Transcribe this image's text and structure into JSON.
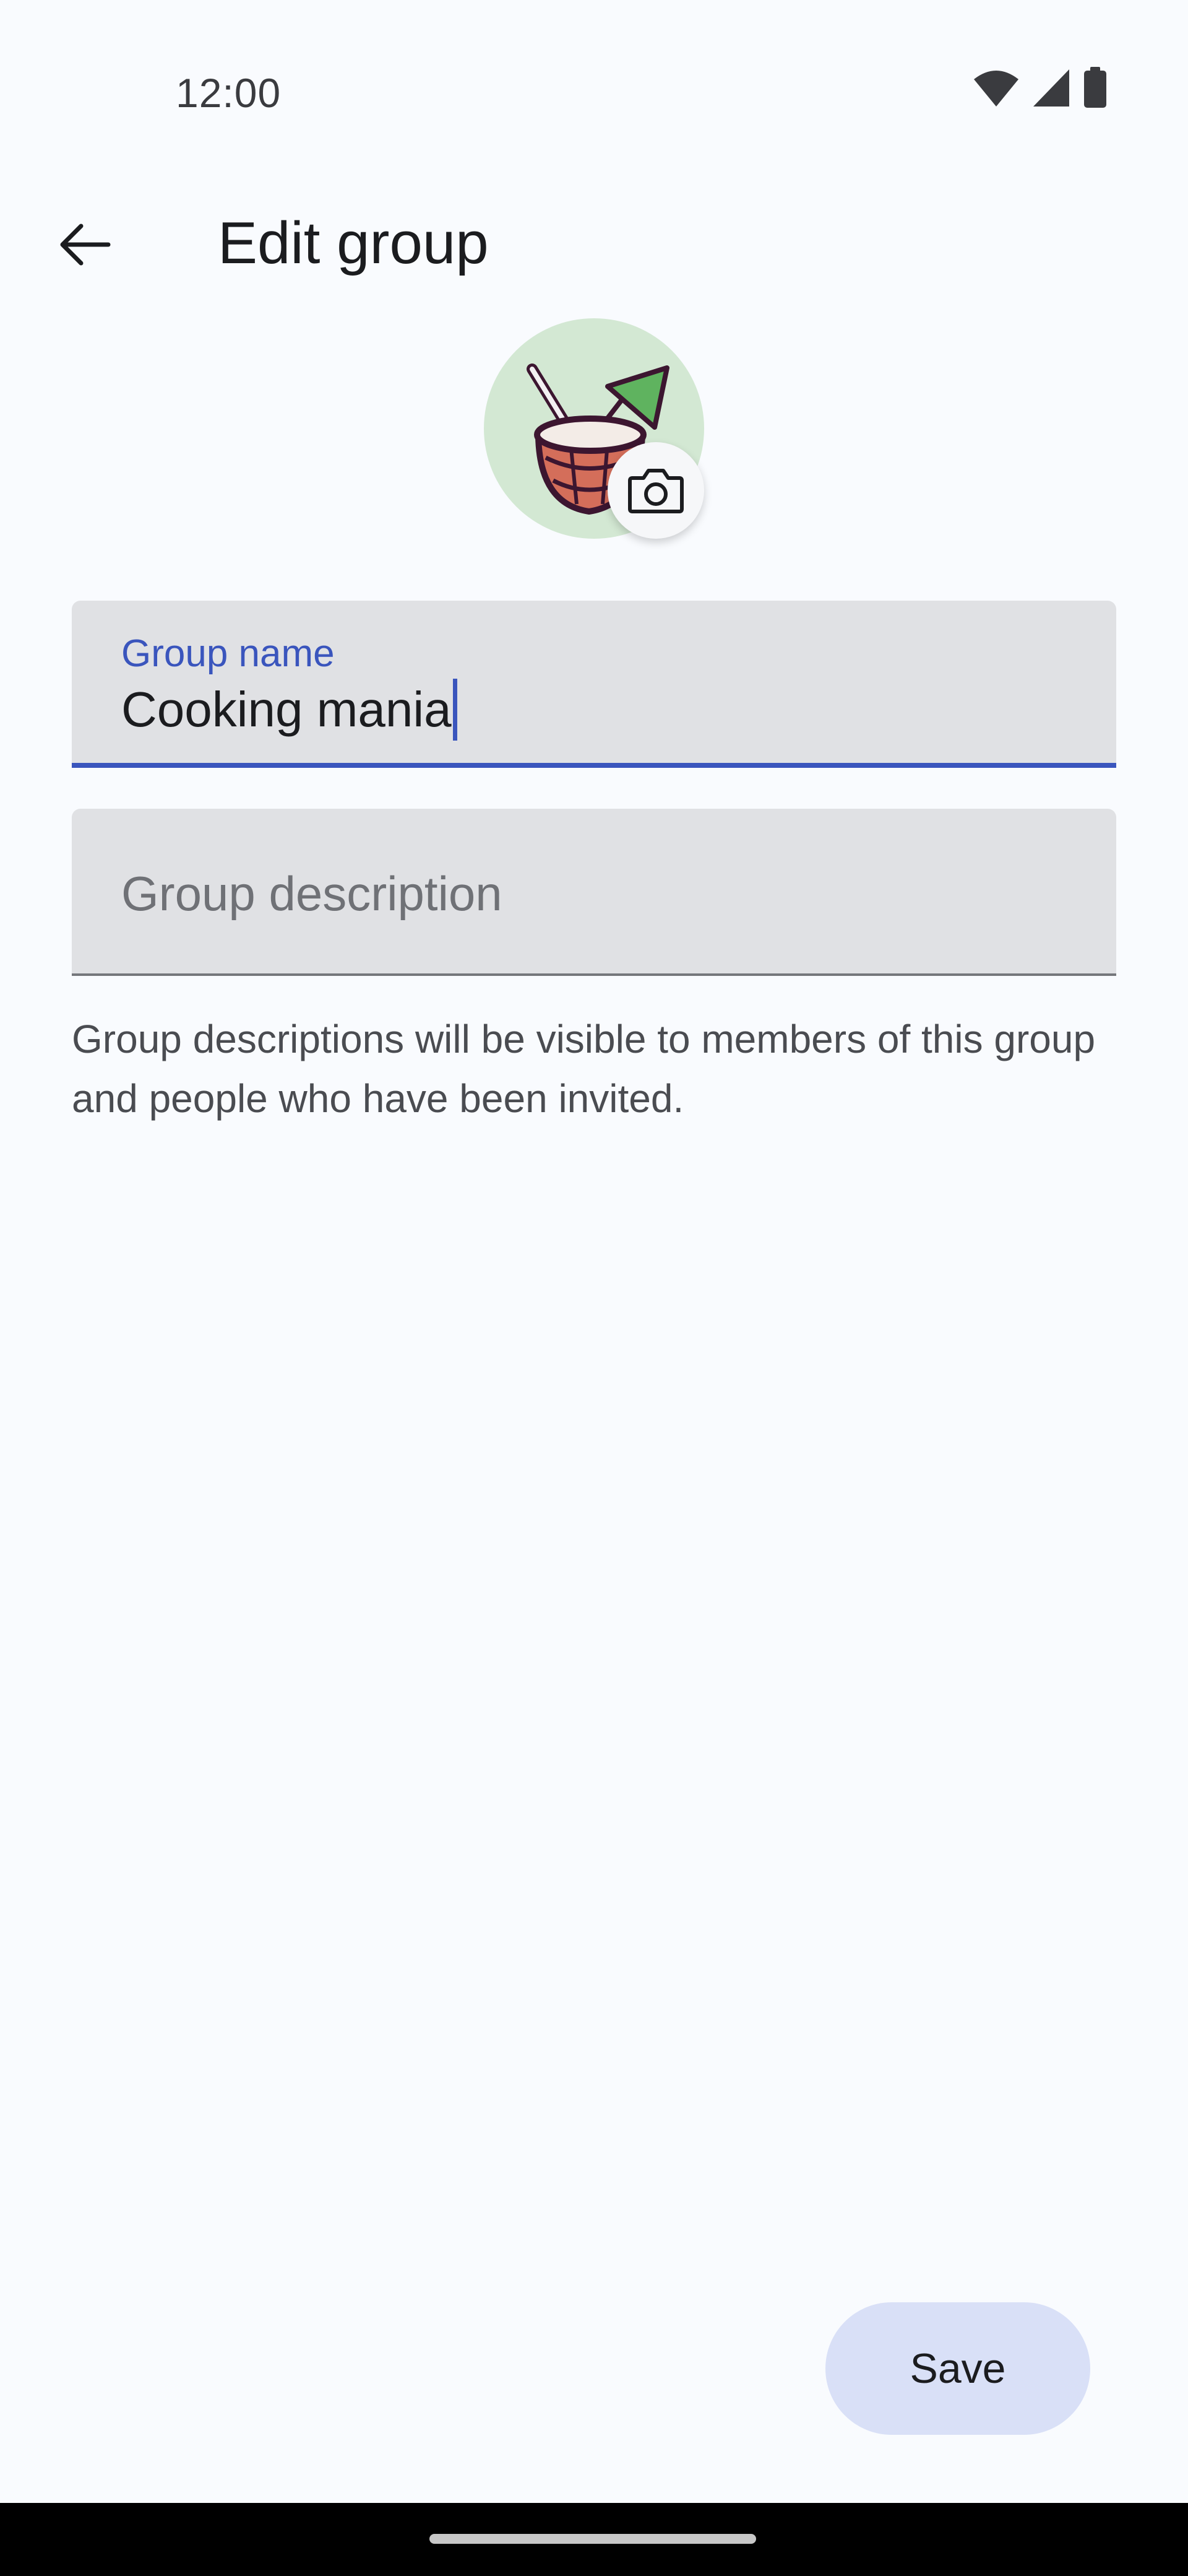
{
  "status_bar": {
    "time": "12:00",
    "icons": [
      "wifi-icon",
      "signal-icon",
      "battery-icon"
    ]
  },
  "app_bar": {
    "title": "Edit group",
    "back_icon": "arrow-back-icon"
  },
  "avatar": {
    "image": "coconut-drink-illustration",
    "camera_icon": "camera-icon"
  },
  "fields": {
    "name": {
      "label": "Group name",
      "value": "Cooking mania"
    },
    "description": {
      "placeholder": "Group description",
      "value": ""
    }
  },
  "helper_text": "Group descriptions will be visible to members of this group and people who have been invited.",
  "actions": {
    "save_label": "Save"
  },
  "colors": {
    "background": "#f9fbfe",
    "accent": "#3a55bd",
    "field_bg": "#e0e1e4",
    "save_bg": "#d9e0f7",
    "avatar_bg": "#d3e8d3"
  }
}
